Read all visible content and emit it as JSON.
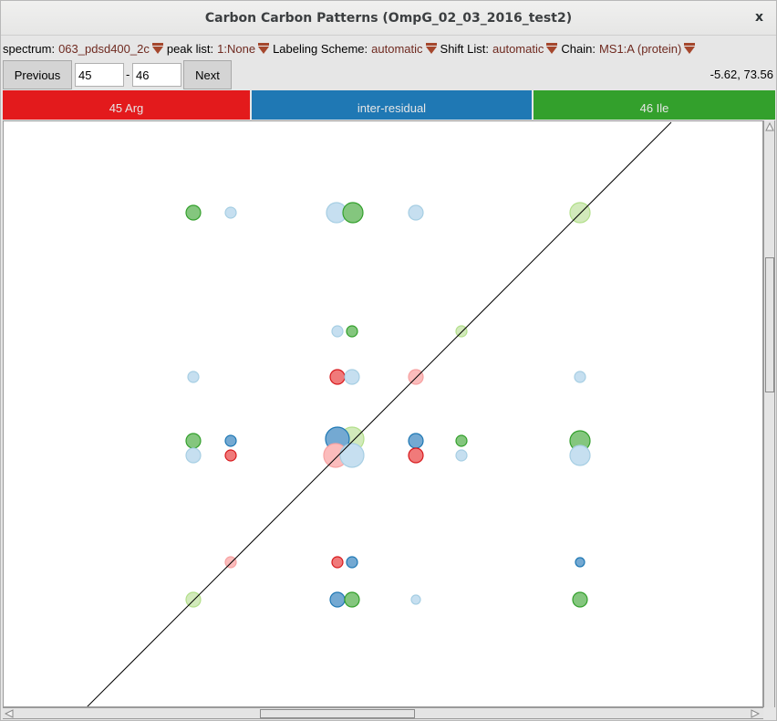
{
  "window": {
    "title": "Carbon Carbon Patterns (OmpG_02_03_2016_test2)",
    "close_label": "x"
  },
  "options": [
    {
      "label": "spectrum:",
      "value": "063_pdsd400_2c",
      "icon": "dropdown-triangle-icon"
    },
    {
      "label": "peak list:",
      "value": "1:None",
      "icon": "dropdown-triangle-icon"
    },
    {
      "label": "Labeling Scheme:",
      "value": "automatic",
      "icon": "dropdown-triangle-icon"
    },
    {
      "label": "Shift List:",
      "value": "automatic",
      "icon": "dropdown-triangle-icon"
    },
    {
      "label": "Chain:",
      "value": "MS1:A (protein)",
      "icon": "dropdown-triangle-icon"
    }
  ],
  "nav": {
    "previous_label": "Previous",
    "next_label": "Next",
    "range_start": "45",
    "range_separator": "-",
    "range_end": "46",
    "cursor_coords": "-5.62, 73.56"
  },
  "bands": [
    {
      "label": "45 Arg",
      "color": "#e31a1c"
    },
    {
      "label": "inter-residual",
      "color": "#1f78b4"
    },
    {
      "label": "46 Ile",
      "color": "#33a02c"
    }
  ],
  "colors": {
    "red": {
      "fill": "#f07a7a",
      "stroke": "#d7191c"
    },
    "lightred": {
      "fill": "#fbbcbc",
      "stroke": "#f7a1a1"
    },
    "blue": {
      "fill": "#74a9d2",
      "stroke": "#1f78b4"
    },
    "lightblue": {
      "fill": "#c6dff0",
      "stroke": "#a6cee3"
    },
    "green": {
      "fill": "#84c67e",
      "stroke": "#33a02c"
    },
    "lightgreen": {
      "fill": "#d2eabb",
      "stroke": "#b2df8a"
    }
  },
  "peaks": [
    {
      "col": 0,
      "row": 0,
      "color": "green",
      "size": "m"
    },
    {
      "col": 1,
      "row": 0,
      "color": "lightblue",
      "size": "s"
    },
    {
      "col": 2,
      "row": 0,
      "color": "lightblue",
      "size": "l"
    },
    {
      "col": 3,
      "row": 0,
      "color": "green",
      "size": "l"
    },
    {
      "col": 4,
      "row": 0,
      "color": "lightblue",
      "size": "m"
    },
    {
      "col": 6,
      "row": 0,
      "color": "lightgreen",
      "size": "l"
    },
    {
      "col": 2,
      "row": 1,
      "color": "lightblue",
      "size": "s"
    },
    {
      "col": 3,
      "row": 1,
      "color": "green",
      "size": "s"
    },
    {
      "col": 5,
      "row": 1,
      "color": "lightgreen",
      "size": "s"
    },
    {
      "col": 0,
      "row": 2,
      "color": "lightblue",
      "size": "s"
    },
    {
      "col": 2,
      "row": 2,
      "color": "red",
      "size": "m"
    },
    {
      "col": 3,
      "row": 2,
      "color": "lightblue",
      "size": "m"
    },
    {
      "col": 4,
      "row": 2,
      "color": "lightred",
      "size": "m"
    },
    {
      "col": 6,
      "row": 2,
      "color": "lightblue",
      "size": "s"
    },
    {
      "col": 0,
      "row": 3,
      "color": "green",
      "size": "m"
    },
    {
      "col": 1,
      "row": 3,
      "color": "blue",
      "size": "s"
    },
    {
      "col": 3,
      "row": 3,
      "color": "lightgreen",
      "size": "xl"
    },
    {
      "col": 2,
      "row": 3,
      "color": "blue",
      "size": "xl"
    },
    {
      "col": 4,
      "row": 3,
      "color": "blue",
      "size": "m"
    },
    {
      "col": 5,
      "row": 3,
      "color": "green",
      "size": "s"
    },
    {
      "col": 6,
      "row": 3,
      "color": "green",
      "size": "l"
    },
    {
      "col": 0,
      "row": 4,
      "color": "lightblue",
      "size": "m"
    },
    {
      "col": 1,
      "row": 4,
      "color": "red",
      "size": "s"
    },
    {
      "col": 2,
      "row": 4,
      "color": "lightred",
      "size": "xl"
    },
    {
      "col": 3,
      "row": 4,
      "color": "lightblue",
      "size": "xl"
    },
    {
      "col": 4,
      "row": 4,
      "color": "red",
      "size": "m"
    },
    {
      "col": 5,
      "row": 4,
      "color": "lightblue",
      "size": "s"
    },
    {
      "col": 6,
      "row": 4,
      "color": "lightblue",
      "size": "l"
    },
    {
      "col": 1,
      "row": 5,
      "color": "lightred",
      "size": "s"
    },
    {
      "col": 2,
      "row": 5,
      "color": "red",
      "size": "s"
    },
    {
      "col": 3,
      "row": 5,
      "color": "blue",
      "size": "s"
    },
    {
      "col": 6,
      "row": 5,
      "color": "blue",
      "size": "xs"
    },
    {
      "col": 0,
      "row": 6,
      "color": "lightgreen",
      "size": "m"
    },
    {
      "col": 2,
      "row": 6,
      "color": "blue",
      "size": "m"
    },
    {
      "col": 3,
      "row": 6,
      "color": "green",
      "size": "m"
    },
    {
      "col": 4,
      "row": 6,
      "color": "lightblue",
      "size": "xs"
    },
    {
      "col": 6,
      "row": 6,
      "color": "green",
      "size": "m"
    }
  ]
}
